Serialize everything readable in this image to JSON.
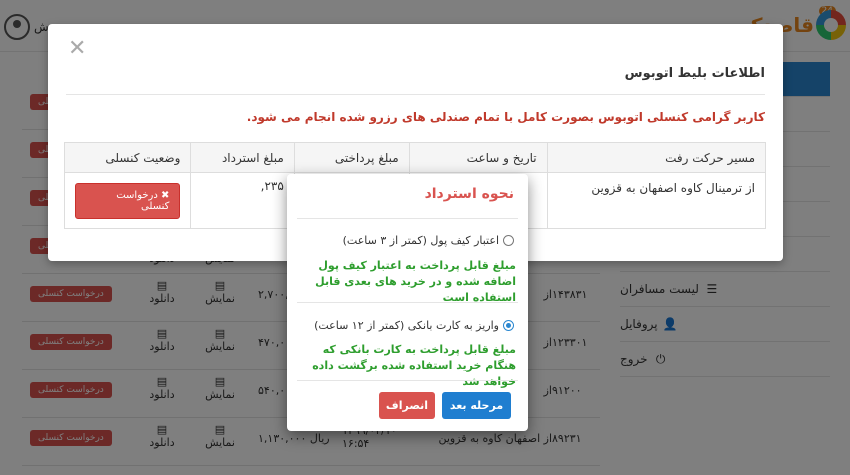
{
  "header": {
    "brand": "قاصدک",
    "brand_badge": "24",
    "user_name": "سعید ش"
  },
  "sidebar": {
    "items": [
      {
        "label": "",
        "icon": "bus-icon",
        "glyph": "🚌",
        "active": true
      },
      {
        "label": "",
        "icon": "train-icon",
        "glyph": "🚆",
        "active": false
      },
      {
        "label": "",
        "icon": "umbrella-icon",
        "glyph": "☂",
        "active": false
      },
      {
        "label": "",
        "icon": "bed-icon",
        "glyph": "🛏",
        "active": false
      },
      {
        "label": "",
        "icon": "suitcase-icon",
        "glyph": "💼",
        "active": false
      },
      {
        "label": "",
        "icon": "money-icon",
        "glyph": "💵",
        "active": false
      },
      {
        "label": "لیست مسافران",
        "icon": "list-icon",
        "glyph": "☰",
        "active": false
      },
      {
        "label": "پروفایل",
        "icon": "user-icon",
        "glyph": "👤",
        "active": false
      },
      {
        "label": "خروج",
        "icon": "power-icon",
        "glyph": "⏻",
        "active": false
      }
    ]
  },
  "bg_table": {
    "download_label": "دانلود",
    "show_label": "نمایش",
    "cancel_label": "درخواست کنسلی",
    "route_prefix": "از",
    "rows": [
      {
        "code": "",
        "route": "",
        "datetime": "",
        "amount": ""
      },
      {
        "code": "",
        "route": "",
        "datetime": "",
        "amount": ""
      },
      {
        "code": "",
        "route": "",
        "datetime": "",
        "amount": ""
      },
      {
        "code": "",
        "route": "",
        "datetime": "",
        "amount": ""
      },
      {
        "code": "۱۴۳۸۳۱",
        "route": "از",
        "datetime": "",
        "amount": "۲,۷۰۰,"
      },
      {
        "code": "۱۲۳۳۰۱",
        "route": "از",
        "datetime": "",
        "amount": "۴۷۰,۰ ریال"
      },
      {
        "code": "۹۱۲۰۰",
        "route": "از",
        "datetime": "",
        "amount": "۵۴۰,۰ ریال"
      },
      {
        "code": "۸۹۲۳۱",
        "route": "از اصفهان کاوه به قزوین",
        "datetime": "۱۳۹۹/۰۴/۱۰ ۱۶:۵۴",
        "amount": "۱,۱۳۰,۰۰۰ ریال"
      }
    ]
  },
  "ticket_modal": {
    "title": "اطلاعات بلیط اتوبوس",
    "note": "کاربر گرامی کنسلی اتوبوس بصورت کامل با تمام صندلی های رزرو شده انجام می شود.",
    "columns": [
      "مسیر حرکت رفت",
      "تاریخ و ساعت",
      "مبلغ پرداختی",
      "مبلغ استرداد",
      "وضعیت کنسلی"
    ],
    "row": {
      "route": "از ترمینال کاوه اصفهان به قزوین",
      "datetime": "",
      "paid": "",
      "refund": "۲۳۵,",
      "action": "✖ درخواست کنسلی"
    }
  },
  "refund_modal": {
    "title": "نحوه استرداد",
    "option1_label": "اعتبار کیف پول (کمتر از ۳ ساعت)",
    "option1_desc": "مبلغ قابل پرداخت به اعتبار کیف پول اضافه شده و در خرید های بعدی قابل استفاده است",
    "option1_selected": false,
    "option2_label": "واریز به کارت بانکی (کمتر از ۱۲ ساعت)",
    "option2_desc": "مبلغ قابل پرداخت به کارت بانکی که هنگام خرید استفاده شده برگشت داده خواهد شد",
    "option2_selected": true,
    "next_label": "مرحله بعد",
    "cancel_label": "انصراف"
  }
}
